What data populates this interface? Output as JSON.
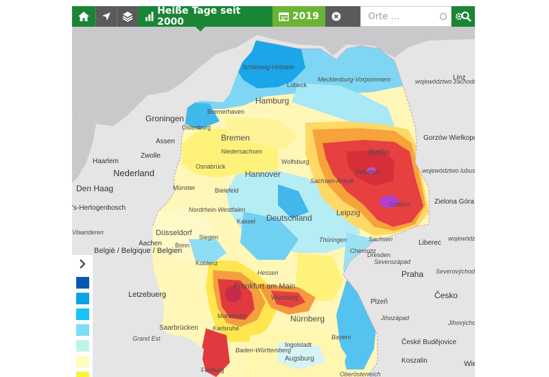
{
  "toolbar": {
    "title": "Heiße Tage seit 2000",
    "year": "2019",
    "search_placeholder": "Orte ...",
    "icons": [
      "home-icon",
      "location-arrow-icon",
      "layers-icon",
      "bar-chart-icon",
      "calendar-icon",
      "close-icon",
      "settings-search-icon"
    ]
  },
  "map_labels": {
    "cities": [
      "Hamburg",
      "Bremen",
      "Hannover",
      "Berlin",
      "Potsdam",
      "Leipzig",
      "Dresden",
      "Deutschland",
      "Nürnberg",
      "Frankfurt am Main",
      "Augsburg",
      "Ingolstadt",
      "Cottbus",
      "Chemnitz",
      "Kassel",
      "Bielefeld",
      "Münster",
      "Osnabrück",
      "Oldenburg",
      "Bremerhaven",
      "Lübeck",
      "Wolfsburg",
      "Siegen",
      "Bonn",
      "Düsseldorf",
      "Koblenz",
      "Saarbrücken",
      "Karlsruhe",
      "Mannheim",
      "Würzburg",
      "Freiburg",
      "Groningen",
      "Assen",
      "Zwolle",
      "Haarlem",
      "Nederland",
      "Den Haag",
      "'s-Hertogenbosch",
      "Aachen",
      "België / Belgique / Belgien",
      "Vlaanderen",
      "Letzebuerg",
      "Praha",
      "Plzeň",
      "Česko",
      "České Budějovice",
      "Linz",
      "Koszalin",
      "Gorzów Wielkopolski",
      "Zielona Góra",
      "Liberec",
      "Wie"
    ],
    "regions": [
      "Schleswig-Holstein",
      "Mecklenburg-Vorpommern",
      "Niedersachsen",
      "Nordrhein-Westfalen",
      "Sachsen-Anhalt",
      "Thüringen",
      "Sachsen",
      "Hessen",
      "Bayern",
      "Baden-Württemberg",
      "województwo zachodniopomorskie",
      "województwo lubuskie",
      "województwo dolnośląskie",
      "Severozápad",
      "Severovýchod",
      "Jihozápad",
      "Jihovýchod",
      "Oberösterreich"
    ]
  },
  "legend": {
    "colors": [
      "#0a57b0",
      "#0aa3e6",
      "#17c4f2",
      "#7fdcf7",
      "#bff5e8",
      "#fffcbe",
      "#fff23c"
    ]
  },
  "colors": {
    "brand_green": "#1a8535",
    "light_green": "#6ab434",
    "toolbar_gray": "#5a5a5a"
  }
}
